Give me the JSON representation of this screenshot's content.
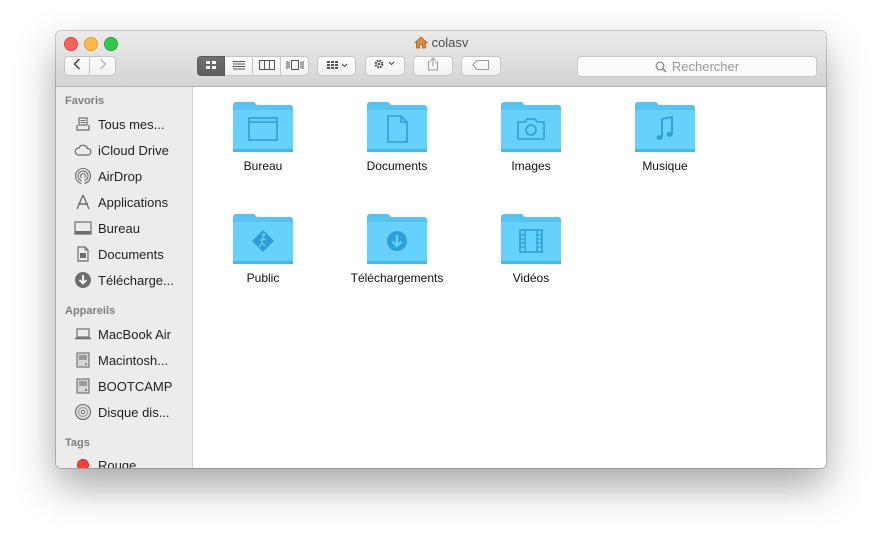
{
  "window": {
    "title": "colasv",
    "search_placeholder": "Rechercher"
  },
  "toolbar": {
    "view_modes": [
      "icon-view",
      "list-view",
      "column-view",
      "cover-flow-view"
    ],
    "active_view": "icon-view"
  },
  "sidebar": {
    "sections": [
      {
        "heading": "Favoris",
        "items": [
          {
            "label": "Tous mes...",
            "icon": "all-files-icon"
          },
          {
            "label": "iCloud Drive",
            "icon": "cloud-icon"
          },
          {
            "label": "AirDrop",
            "icon": "airdrop-icon"
          },
          {
            "label": "Applications",
            "icon": "applications-icon"
          },
          {
            "label": "Bureau",
            "icon": "desktop-icon"
          },
          {
            "label": "Documents",
            "icon": "document-icon"
          },
          {
            "label": "Télécharge...",
            "icon": "download-icon"
          }
        ]
      },
      {
        "heading": "Appareils",
        "items": [
          {
            "label": "MacBook Air",
            "icon": "laptop-icon"
          },
          {
            "label": "Macintosh...",
            "icon": "hard-drive-icon"
          },
          {
            "label": "BOOTCAMP",
            "icon": "hard-drive-icon"
          },
          {
            "label": "Disque dis...",
            "icon": "disc-icon"
          }
        ]
      },
      {
        "heading": "Tags",
        "items": [
          {
            "label": "Rouge",
            "icon": "red-tag-icon",
            "color": "#fc3d39"
          }
        ]
      }
    ]
  },
  "folders": [
    {
      "label": "Bureau",
      "icon": "desktop-folder-icon"
    },
    {
      "label": "Documents",
      "icon": "documents-folder-icon"
    },
    {
      "label": "Images",
      "icon": "pictures-folder-icon"
    },
    {
      "label": "Musique",
      "icon": "music-folder-icon"
    },
    {
      "label": "Public",
      "icon": "public-folder-icon"
    },
    {
      "label": "Téléchargements",
      "icon": "downloads-folder-icon"
    },
    {
      "label": "Vidéos",
      "icon": "movies-folder-icon"
    }
  ],
  "colors": {
    "folder_back": "#5cc6f4",
    "folder_front": "#63d0fb",
    "folder_glyph": "#2a9fd8"
  }
}
